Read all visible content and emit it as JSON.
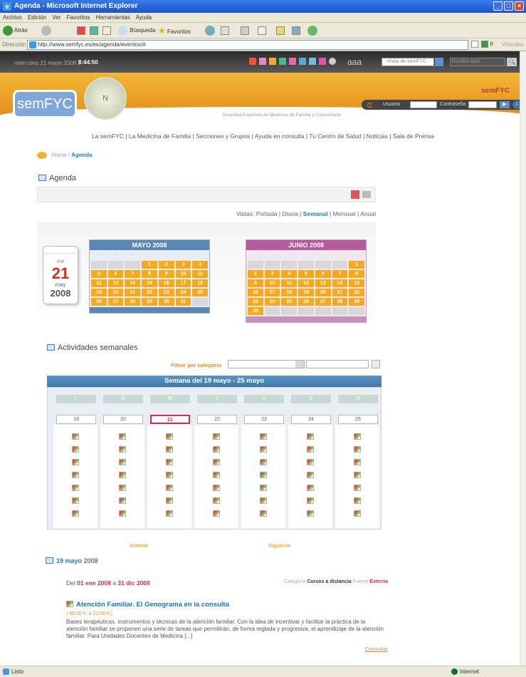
{
  "window": {
    "title": "Agenda - Microsoft Internet Explorer"
  },
  "menu": [
    "Archivo",
    "Edición",
    "Ver",
    "Favoritos",
    "Herramientas",
    "Ayuda"
  ],
  "toolbar": {
    "back": "Atrás",
    "search": "Búsqueda",
    "favorites": "Favoritos"
  },
  "address": {
    "label": "Dirección",
    "url": "http://www.semfyc.es/es/agenda/eventos/#",
    "go": "Ir",
    "links": "Vínculos"
  },
  "topbar": {
    "date": "miércoles 21 mayo 2008 |",
    "time": "8:44:50",
    "aaa": "aaa",
    "visit_select": "- Visita de semFYC -",
    "search_placeholder": "Escriba aquí"
  },
  "header": {
    "logo": "semFYC",
    "brand": "semFYC",
    "subtitle": "Sociedad Española de Medicina de Familia y Comunitaria",
    "user_label": "Usuario",
    "password_label": "Contraseña"
  },
  "nav": "La semFYC | La Medicina de Familia | Secciones y Grupos | Ayuda en consulta | Tu Centro de Salud | Noticias | Sala de Prensa",
  "breadcrumb": {
    "home": "Home /",
    "current": "Agenda"
  },
  "page_title": "Agenda",
  "views": {
    "prefix": "Vistas:",
    "portada": "Portada",
    "diaria": "Diaria",
    "semanal": "Semanal",
    "mensual": "Mensual",
    "anual": "Anual",
    "sep": "|"
  },
  "datecard": {
    "dow": "mié",
    "day": "21",
    "month": "may",
    "year": "2008"
  },
  "weekday_heads": [
    "L",
    "M",
    "M",
    "J",
    "V",
    "S",
    "D"
  ],
  "may": {
    "title": "MAYO 2008",
    "cells": [
      "",
      "",
      "",
      "1",
      "2",
      "3",
      "4",
      "5",
      "6",
      "7",
      "8",
      "9",
      "10",
      "11",
      "12",
      "13",
      "14",
      "15",
      "16",
      "17",
      "18",
      "19",
      "20",
      "21",
      "22",
      "23",
      "24",
      "25",
      "26",
      "27",
      "28",
      "29",
      "30",
      "31",
      ""
    ]
  },
  "june": {
    "title": "JUNIO 2008",
    "cells": [
      "",
      "",
      "",
      "",
      "",
      "",
      "1",
      "2",
      "3",
      "4",
      "5",
      "6",
      "7",
      "8",
      "9",
      "10",
      "11",
      "12",
      "13",
      "14",
      "15",
      "16",
      "17",
      "18",
      "19",
      "20",
      "21",
      "22",
      "23",
      "24",
      "25",
      "26",
      "27",
      "28",
      "29",
      "30",
      "",
      "",
      "",
      "",
      "",
      ""
    ]
  },
  "weekly": {
    "title": "Actividades semanales",
    "filter_label": "Filtrar por categoría",
    "week_title": "Semana del 19 mayo - 25 mayo",
    "days": [
      "L",
      "M",
      "M",
      "J",
      "V",
      "S",
      "D"
    ],
    "dates": [
      "19",
      "20",
      "21",
      "22",
      "23",
      "24",
      "25"
    ],
    "today_index": 2,
    "prev": "Anterior",
    "next": "Siguiente"
  },
  "day_heading": {
    "date": "19 mayo",
    "year": "2008"
  },
  "event": {
    "range_prefix": "Del",
    "range_from": "01 ene 2008",
    "range_mid": "a",
    "range_to": "31 dic 2008",
    "category_label": "Categoría",
    "category": "Cursos a distancia",
    "source_label": "Fuente",
    "source": "Externa",
    "title": "Atención Familiar. El Genograma en la consulta",
    "price": "( 60.00 h. a 23.00 h.)",
    "description": "Bases terapéuticas, instrumentos y técnicas de la atención familiar. Con la idea de incentivar y facilitar la práctica de la atención familiar se proponen una serie de tareas que permitirán, de forma reglada y progresiva, el aprendizaje de la atención familiar. Para Unidades Docentes de Medicina [...]",
    "more": "Consultar"
  },
  "status": {
    "left": "Listo",
    "zone": "Internet"
  }
}
